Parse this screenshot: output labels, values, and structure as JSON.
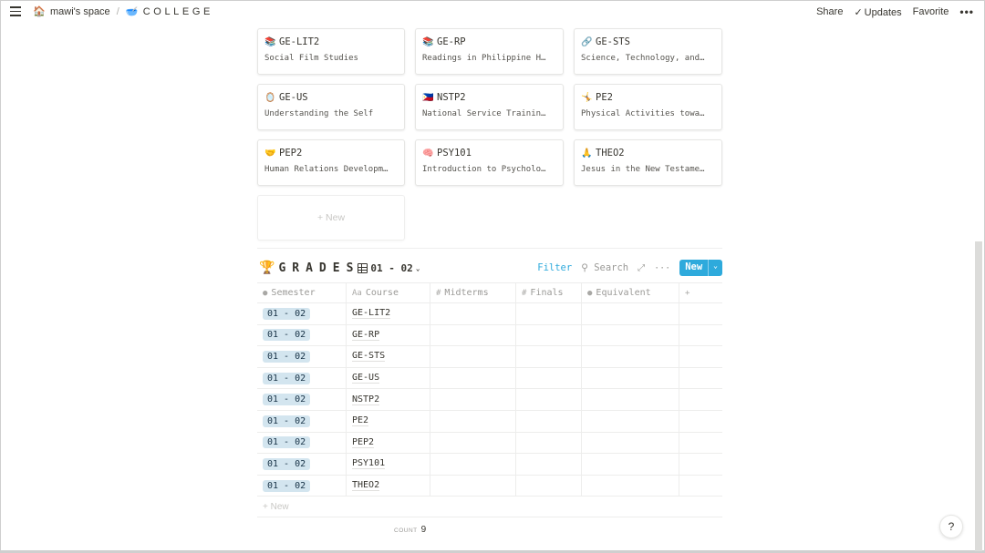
{
  "topbar": {
    "workspace_icon": "🏠",
    "workspace": "mawi's space",
    "separator": "/",
    "page_icon": "🥣",
    "page": "COLLEGE",
    "share": "Share",
    "updates_icon": "✓",
    "updates": "Updates",
    "favorite": "Favorite",
    "more": "•••"
  },
  "gallery": {
    "cards": [
      {
        "emoji": "📚",
        "code": "GE-LIT2",
        "name": "Social Film Studies"
      },
      {
        "emoji": "📚",
        "code": "GE-RP",
        "name": "Readings in Philippine H…"
      },
      {
        "emoji": "🔗",
        "code": "GE-STS",
        "name": "Science, Technology, and…"
      },
      {
        "emoji": "🪞",
        "code": "GE-US",
        "name": "Understanding the Self"
      },
      {
        "emoji": "🇵🇭",
        "code": "NSTP2",
        "name": "National Service Trainin…"
      },
      {
        "emoji": "🤸",
        "code": "PE2",
        "name": "Physical Activities towa…"
      },
      {
        "emoji": "🤝",
        "code": "PEP2",
        "name": "Human Relations Developm…"
      },
      {
        "emoji": "🧠",
        "code": "PSY101",
        "name": "Introduction to Psycholo…"
      },
      {
        "emoji": "🙏",
        "code": "THEO2",
        "name": "Jesus in the New Testame…"
      }
    ],
    "new_label": "+ New"
  },
  "grades": {
    "icon": "🏆",
    "title": "GRADES",
    "view": "01 - 02",
    "filter": "Filter",
    "search": "Search",
    "expand": "⤢",
    "more": "···",
    "new": "New",
    "new_dropdown": "⌄",
    "columns": [
      {
        "icon": "●",
        "label": "Semester"
      },
      {
        "icon": "Aa",
        "label": "Course"
      },
      {
        "icon": "#",
        "label": "Midterms"
      },
      {
        "icon": "#",
        "label": "Finals"
      },
      {
        "icon": "●",
        "label": "Equivalent"
      },
      {
        "icon": "+",
        "label": ""
      }
    ],
    "rows": [
      {
        "semester": "01 - 02",
        "course": "GE-LIT2",
        "midterms": "",
        "finals": "",
        "equivalent": ""
      },
      {
        "semester": "01 - 02",
        "course": "GE-RP",
        "midterms": "",
        "finals": "",
        "equivalent": ""
      },
      {
        "semester": "01 - 02",
        "course": "GE-STS",
        "midterms": "",
        "finals": "",
        "equivalent": ""
      },
      {
        "semester": "01 - 02",
        "course": "GE-US",
        "midterms": "",
        "finals": "",
        "equivalent": ""
      },
      {
        "semester": "01 - 02",
        "course": "NSTP2",
        "midterms": "",
        "finals": "",
        "equivalent": ""
      },
      {
        "semester": "01 - 02",
        "course": "PE2",
        "midterms": "",
        "finals": "",
        "equivalent": ""
      },
      {
        "semester": "01 - 02",
        "course": "PEP2",
        "midterms": "",
        "finals": "",
        "equivalent": ""
      },
      {
        "semester": "01 - 02",
        "course": "PSY101",
        "midterms": "",
        "finals": "",
        "equivalent": ""
      },
      {
        "semester": "01 - 02",
        "course": "THEO2",
        "midterms": "",
        "finals": "",
        "equivalent": ""
      }
    ],
    "new_row": "+ New",
    "count_label": "COUNT",
    "count_value": "9",
    "tag_color": "#d3e5ef"
  },
  "help": "?",
  "colors": {
    "accent": "#2eaadc",
    "text": "#37352f",
    "muted": "#9b9a97"
  }
}
